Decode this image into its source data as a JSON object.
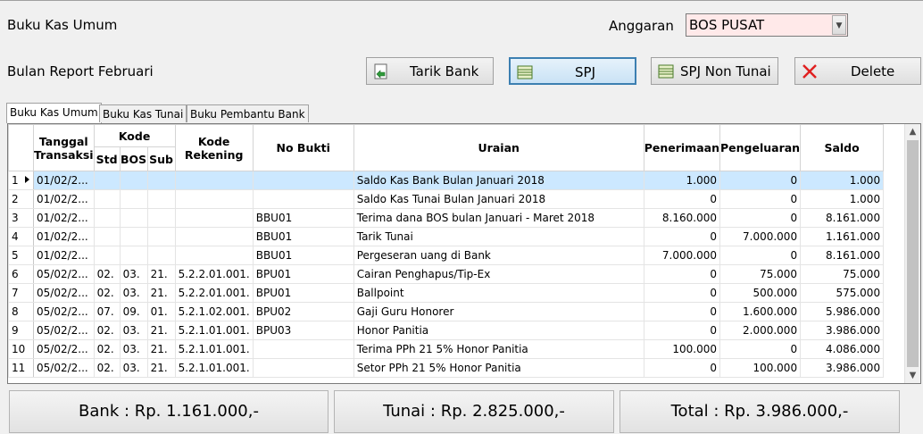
{
  "header": {
    "title": "Buku Kas Umum",
    "anggaran_label": "Anggaran",
    "anggaran_value": "BOS PUSAT",
    "bulan_report": "Bulan Report Februari"
  },
  "toolbar": {
    "tarik_bank": "Tarik Bank",
    "spj": "SPJ",
    "spj_non_tunai": "SPJ Non Tunai",
    "delete": "Delete"
  },
  "tabs": [
    "Buku Kas Umum",
    "Buku Kas Tunai",
    "Buku Pembantu Bank"
  ],
  "grid": {
    "headers": {
      "tanggal": "Tanggal Transaksi",
      "kode": "Kode",
      "std": "Std",
      "bos": "BOS",
      "sub": "Sub",
      "kode_rekening": "Kode Rekening",
      "no_bukti": "No Bukti",
      "uraian": "Uraian",
      "penerimaan": "Penerimaan",
      "pengeluaran": "Pengeluaran",
      "saldo": "Saldo"
    },
    "rows": [
      {
        "no": "1",
        "tgl": "01/02/2...",
        "std": "",
        "bos": "",
        "sub": "",
        "rek": "",
        "bukti": "",
        "uraian": "Saldo Kas Bank Bulan Januari 2018",
        "terima": "1.000",
        "keluar": "0",
        "saldo": "1.000"
      },
      {
        "no": "2",
        "tgl": "01/02/2...",
        "std": "",
        "bos": "",
        "sub": "",
        "rek": "",
        "bukti": "",
        "uraian": "Saldo Kas Tunai Bulan Januari 2018",
        "terima": "0",
        "keluar": "0",
        "saldo": "1.000"
      },
      {
        "no": "3",
        "tgl": "01/02/2...",
        "std": "",
        "bos": "",
        "sub": "",
        "rek": "",
        "bukti": "BBU01",
        "uraian": "Terima dana BOS bulan Januari - Maret 2018",
        "terima": "8.160.000",
        "keluar": "0",
        "saldo": "8.161.000"
      },
      {
        "no": "4",
        "tgl": "01/02/2...",
        "std": "",
        "bos": "",
        "sub": "",
        "rek": "",
        "bukti": "BBU01",
        "uraian": "Tarik Tunai",
        "terima": "0",
        "keluar": "7.000.000",
        "saldo": "1.161.000"
      },
      {
        "no": "5",
        "tgl": "01/02/2...",
        "std": "",
        "bos": "",
        "sub": "",
        "rek": "",
        "bukti": "BBU01",
        "uraian": "Pergeseran uang di Bank",
        "terima": "7.000.000",
        "keluar": "0",
        "saldo": "8.161.000"
      },
      {
        "no": "6",
        "tgl": "05/02/2...",
        "std": "02.",
        "bos": "03.",
        "sub": "21.",
        "rek": "5.2.2.01.001.",
        "bukti": "BPU01",
        "uraian": "Cairan Penghapus/Tip-Ex",
        "terima": "0",
        "keluar": "75.000",
        "saldo": "75.000"
      },
      {
        "no": "7",
        "tgl": "05/02/2...",
        "std": "02.",
        "bos": "03.",
        "sub": "21.",
        "rek": "5.2.2.01.001.",
        "bukti": "BPU01",
        "uraian": "Ballpoint",
        "terima": "0",
        "keluar": "500.000",
        "saldo": "575.000"
      },
      {
        "no": "8",
        "tgl": "05/02/2...",
        "std": "07.",
        "bos": "09.",
        "sub": "01.",
        "rek": "5.2.1.02.001.",
        "bukti": "BPU02",
        "uraian": "Gaji Guru Honorer",
        "terima": "0",
        "keluar": "1.600.000",
        "saldo": "5.986.000"
      },
      {
        "no": "9",
        "tgl": "05/02/2...",
        "std": "02.",
        "bos": "03.",
        "sub": "21.",
        "rek": "5.2.1.01.001.",
        "bukti": "BPU03",
        "uraian": "Honor Panitia",
        "terima": "0",
        "keluar": "2.000.000",
        "saldo": "3.986.000"
      },
      {
        "no": "10",
        "tgl": "05/02/2...",
        "std": "02.",
        "bos": "03.",
        "sub": "21.",
        "rek": "5.2.1.01.001.",
        "bukti": "",
        "uraian": "Terima PPh 21 5% Honor Panitia",
        "terima": "100.000",
        "keluar": "0",
        "saldo": "4.086.000"
      },
      {
        "no": "11",
        "tgl": "05/02/2...",
        "std": "02.",
        "bos": "03.",
        "sub": "21.",
        "rek": "5.2.1.01.001.",
        "bukti": "",
        "uraian": "Setor PPh 21 5% Honor Panitia",
        "terima": "0",
        "keluar": "100.000",
        "saldo": "3.986.000"
      }
    ]
  },
  "summary": {
    "bank": "Bank : Rp. 1.161.000,-",
    "tunai": "Tunai : Rp. 2.825.000,-",
    "total": "Total : Rp. 3.986.000,-"
  }
}
